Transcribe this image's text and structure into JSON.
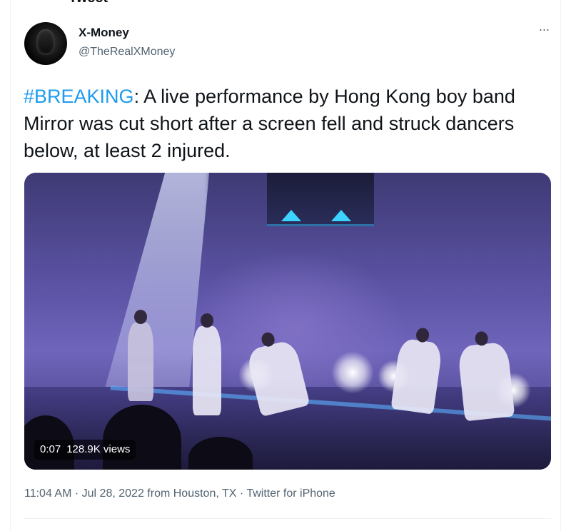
{
  "page": {
    "title": "Tweet"
  },
  "tweet": {
    "author": {
      "display_name": "X-Money",
      "handle": "@TheRealXMoney"
    },
    "more_icon": "more-horizontal-icon",
    "text": {
      "hashtag": "#BREAKING",
      "body": ": A live performance by Hong Kong boy band Mirror was cut short after a screen fell and struck dancers below, at least 2 injured."
    },
    "media": {
      "type": "video",
      "duration": "0:07",
      "views": "128.9K views"
    },
    "meta": {
      "time": "11:04 AM",
      "separator1": "·",
      "date": "Jul 28, 2022",
      "location": "from Houston, TX",
      "separator2": "·",
      "source": "Twitter for iPhone"
    }
  },
  "colors": {
    "link": "#1d9bf0",
    "secondary_text": "#536471",
    "primary_text": "#0f1419"
  }
}
